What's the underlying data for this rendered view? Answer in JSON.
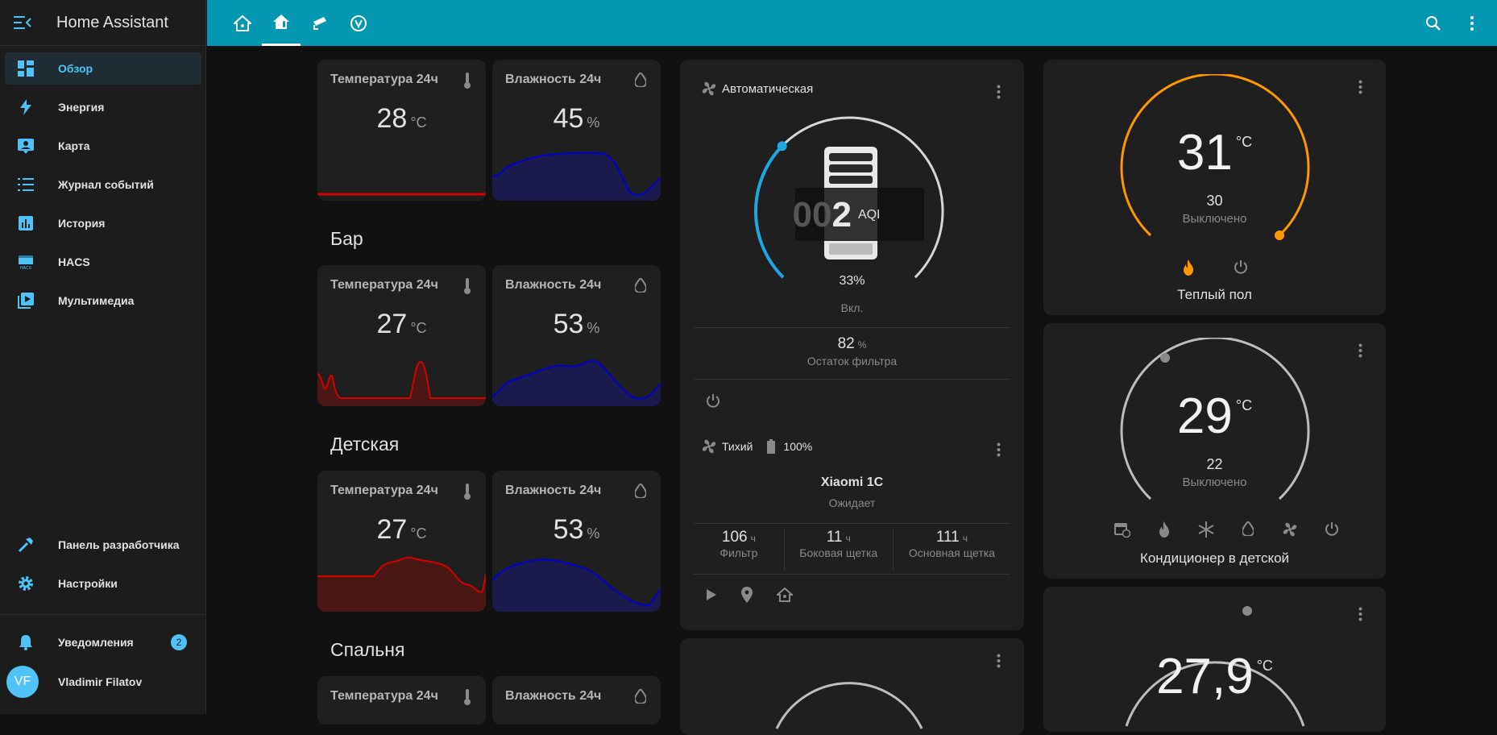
{
  "app": {
    "title": "Home Assistant"
  },
  "sidebar": {
    "items": [
      {
        "label": "Обзор",
        "icon": "dashboard-icon"
      },
      {
        "label": "Энергия",
        "icon": "lightning-icon"
      },
      {
        "label": "Карта",
        "icon": "map-icon"
      },
      {
        "label": "Журнал событий",
        "icon": "list-icon"
      },
      {
        "label": "История",
        "icon": "chart-icon"
      },
      {
        "label": "HACS",
        "icon": "hacs-icon"
      },
      {
        "label": "Мультимедиа",
        "icon": "media-icon"
      }
    ],
    "dev_tools": "Панель разработчика",
    "settings": "Настройки",
    "notifications": "Уведомления",
    "notification_count": "2",
    "user_initials": "VF",
    "user_name": "Vladimir Filatov"
  },
  "rooms": [
    {
      "title": "",
      "temp": {
        "name": "Температура 24ч",
        "value": "28",
        "unit": "°C"
      },
      "hum": {
        "name": "Влажность 24ч",
        "value": "45",
        "unit": "%"
      }
    },
    {
      "title": "Бар",
      "temp": {
        "name": "Температура 24ч",
        "value": "27",
        "unit": "°C"
      },
      "hum": {
        "name": "Влажность 24ч",
        "value": "53",
        "unit": "%"
      }
    },
    {
      "title": "Детская",
      "temp": {
        "name": "Температура 24ч",
        "value": "27",
        "unit": "°C"
      },
      "hum": {
        "name": "Влажность 24ч",
        "value": "53",
        "unit": "%"
      }
    },
    {
      "title": "Спальня",
      "temp": {
        "name": "Температура 24ч",
        "value": "",
        "unit": ""
      },
      "hum": {
        "name": "Влажность 24ч",
        "value": "",
        "unit": ""
      }
    }
  ],
  "purifier": {
    "mode": "Автоматическая",
    "aqi_dim": "00",
    "aqi": "2",
    "aqi_label": "AQI",
    "percent": "33%",
    "percent_value": 33,
    "state": "Вкл.",
    "filter_value": "82",
    "filter_unit": "%",
    "filter_label": "Остаток фильтра"
  },
  "vacuum": {
    "fan_mode": "Тихий",
    "battery": "100%",
    "name": "Xiaomi 1C",
    "status": "Ожидает",
    "stats": [
      {
        "value": "106",
        "unit": "ч",
        "label": "Фильтр"
      },
      {
        "value": "11",
        "unit": "ч",
        "label": "Боковая щетка"
      },
      {
        "value": "111",
        "unit": "ч",
        "label": "Основная щетка"
      }
    ]
  },
  "thermostats": [
    {
      "temp": "31",
      "unit": "°C",
      "target": "30",
      "state": "Выключено",
      "name": "Теплый пол",
      "accent": "#ff9800"
    },
    {
      "temp": "29",
      "unit": "°C",
      "target": "22",
      "state": "Выключено",
      "name": "Кондиционер в детской",
      "accent": "#bdbdbd"
    },
    {
      "temp": "27,9",
      "unit": "°C",
      "target": "",
      "state": "",
      "name": "",
      "accent": "#bdbdbd"
    }
  ],
  "colors": {
    "accent": "#0397b2",
    "active": "#4fc3f7",
    "temp_line": "#d40000",
    "hum_line": "#0000d4",
    "heat": "#ff9800"
  }
}
